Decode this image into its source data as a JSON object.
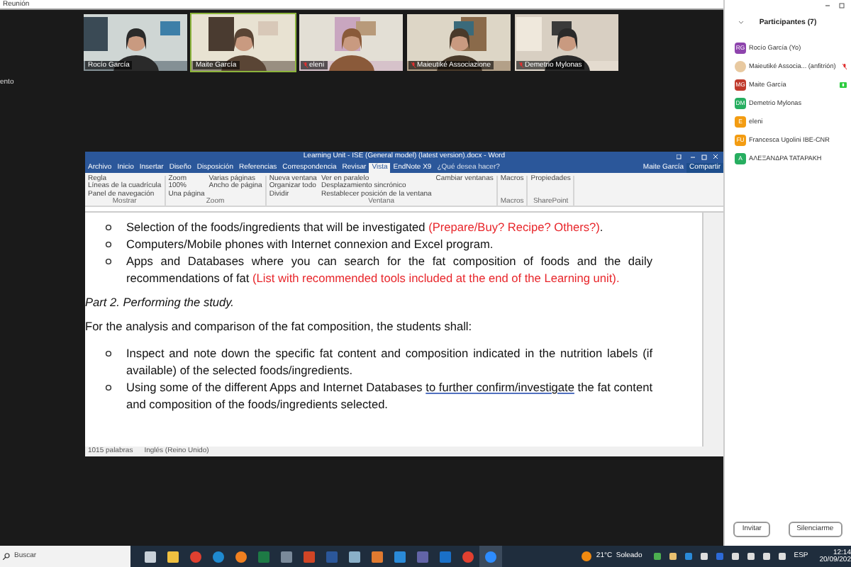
{
  "window": {
    "title": "Reunión"
  },
  "videos": [
    {
      "name": "Rocío García",
      "muted": false,
      "active": false
    },
    {
      "name": "Maite García",
      "muted": false,
      "active": true
    },
    {
      "name": "eleni",
      "muted": true,
      "active": false
    },
    {
      "name": "Maieutiké Associazione",
      "muted": true,
      "active": false
    },
    {
      "name": "Demetrio Mylonas",
      "muted": true,
      "active": false
    }
  ],
  "side_text": "ento",
  "word": {
    "title": "Learning Unit - ISE (General model) (latest version).docx - Word",
    "tabs": [
      {
        "label": "Archivo",
        "selected": false
      },
      {
        "label": "Inicio",
        "selected": false
      },
      {
        "label": "Insertar",
        "selected": false
      },
      {
        "label": "Diseño",
        "selected": false
      },
      {
        "label": "Disposición",
        "selected": false
      },
      {
        "label": "Referencias",
        "selected": false
      },
      {
        "label": "Correspondencia",
        "selected": false
      },
      {
        "label": "Revisar",
        "selected": false
      },
      {
        "label": "Vista",
        "selected": true
      },
      {
        "label": "EndNote X9",
        "selected": false
      }
    ],
    "tell_me": "¿Qué desea hacer?",
    "user": "Maite García",
    "share": "Compartir",
    "ribbon": [
      {
        "label": "Mostrar",
        "items": [
          "Regla",
          "Líneas de la cuadrícula",
          "Panel de navegación"
        ]
      },
      {
        "label": "Zoom",
        "items": [
          "Zoom",
          "100%",
          "Una página",
          "Varias páginas",
          "Ancho de página"
        ]
      },
      {
        "label": "Ventana",
        "items": [
          "Nueva ventana",
          "Organizar todo",
          "Dividir",
          "Ver en paralelo",
          "Desplazamiento sincrónico",
          "Restablecer posición de la ventana",
          "Cambiar ventanas"
        ]
      },
      {
        "label": "Macros",
        "items": [
          "Macros"
        ]
      },
      {
        "label": "SharePoint",
        "items": [
          "Propiedades"
        ]
      }
    ],
    "blocks": [
      {
        "kind": "bullet",
        "segments": [
          {
            "text": "Selection of the foods/ingredients that will be investigated ",
            "kind": "plain"
          },
          {
            "text": "(Prepare/Buy? Recipe? Others?)",
            "kind": "highlight"
          },
          {
            "text": ".",
            "kind": "plain"
          }
        ]
      },
      {
        "kind": "bullet",
        "segments": [
          {
            "text": "Computers/Mobile phones with Internet connexion and Excel program.",
            "kind": "plain"
          }
        ]
      },
      {
        "kind": "bullet",
        "segments": [
          {
            "text": "Apps and Databases where you can search for the fat composition of foods and the daily recommendations of fat ",
            "kind": "plain"
          },
          {
            "text": "(List with recommended tools included at the end of the Learning unit).",
            "kind": "highlight"
          }
        ]
      },
      {
        "kind": "heading",
        "segments": [
          {
            "text": "Part 2. Performing the study.",
            "kind": "plain"
          }
        ]
      },
      {
        "kind": "para",
        "segments": [
          {
            "text": "For the analysis and comparison of the fat composition, the students shall:",
            "kind": "plain"
          }
        ]
      },
      {
        "kind": "bullet",
        "segments": [
          {
            "text": "Inspect and note down the specific fat content and composition indicated in the nutrition labels (if available) of the selected foods/ingredients.",
            "kind": "plain"
          }
        ]
      },
      {
        "kind": "bullet",
        "segments": [
          {
            "text": "Using some of the different Apps and Internet Databases ",
            "kind": "plain"
          },
          {
            "text": "to further confirm/investigate",
            "kind": "grammar"
          },
          {
            "text": " the fat content and composition of the foods/ingredients selected.",
            "kind": "plain"
          }
        ]
      }
    ],
    "status": [
      "1015 palabras",
      "Inglés (Reino Unido)"
    ]
  },
  "participants": {
    "title": "Participantes (7)",
    "people": [
      {
        "initials": "RG",
        "name": "Rocío García (Yo)",
        "color": "#8e44ad",
        "kind": "initials",
        "muted": false,
        "speaking": false
      },
      {
        "name": "Maieutiké Associa... (anfitrión)",
        "muted": true,
        "speaking": false
      },
      {
        "initials": "MG",
        "name": "Maite García",
        "color": "#c0392b",
        "kind": "initials",
        "muted": false,
        "speaking": true
      },
      {
        "initials": "DM",
        "name": "Demetrio Mylonas",
        "color": "#27ae60",
        "kind": "initials",
        "muted": false,
        "speaking": false
      },
      {
        "initials": "E",
        "name": "eleni",
        "color": "#f39c12",
        "kind": "initials",
        "muted": false,
        "speaking": false
      },
      {
        "initials": "FU",
        "name": "Francesca Ugolini IBE-CNR",
        "color": "#f39c12",
        "kind": "initials",
        "muted": false,
        "speaking": false
      },
      {
        "initials": "A",
        "name": "ΑΛΕΞΑΝΔΡΑ ΤΑΤΑΡΑΚΗ",
        "color": "#27ae60",
        "kind": "initials",
        "muted": false,
        "speaking": false
      }
    ],
    "buttons": [
      "Invitar",
      "Silenciarme"
    ]
  },
  "taskbar": {
    "search": "Buscar",
    "weather": "21°C  Soleado",
    "language": "ESP",
    "time": "12:14",
    "date": "20/09/202"
  }
}
